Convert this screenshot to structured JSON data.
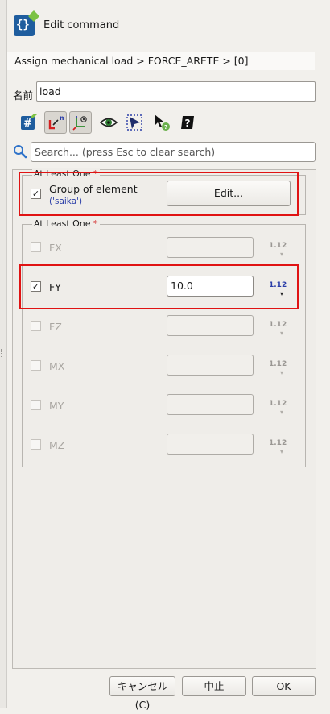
{
  "header": {
    "title": "Edit command"
  },
  "path": "Assign mechanical load > FORCE_ARETE > [0]",
  "name": {
    "label": "名前",
    "value": "load"
  },
  "toolbar": [
    {
      "icon": "hash-icon",
      "pressed": false
    },
    {
      "icon": "local-frame-icon",
      "pressed": true
    },
    {
      "icon": "axes-view-icon",
      "pressed": true
    },
    {
      "icon": "eye-icon",
      "pressed": false
    },
    {
      "icon": "select-arrow-icon",
      "pressed": false
    },
    {
      "icon": "cursor-help-icon",
      "pressed": false
    },
    {
      "icon": "question-book-icon",
      "pressed": false
    }
  ],
  "search": {
    "placeholder": "Search... (press Esc to clear search)"
  },
  "group1": {
    "title": "At Least One",
    "required": "*",
    "item": {
      "label": "Group of element",
      "checked": true,
      "sublabel": "('saika')",
      "button": "Edit..."
    }
  },
  "group2": {
    "title": "At Least One",
    "required": "*",
    "unit": "1.12",
    "caret": "▾",
    "rows": [
      {
        "label": "FX",
        "checked": false,
        "enabled": false,
        "value": ""
      },
      {
        "label": "FY",
        "checked": true,
        "enabled": true,
        "value": "10.0"
      },
      {
        "label": "FZ",
        "checked": false,
        "enabled": false,
        "value": ""
      },
      {
        "label": "MX",
        "checked": false,
        "enabled": false,
        "value": ""
      },
      {
        "label": "MY",
        "checked": false,
        "enabled": false,
        "value": ""
      },
      {
        "label": "MZ",
        "checked": false,
        "enabled": false,
        "value": ""
      }
    ]
  },
  "footer": {
    "cancel": "キャンセル(C)",
    "abort": "中止",
    "ok": "OK"
  },
  "colors": {
    "accent": "#2b3ea8",
    "highlight": "#e01313",
    "brand": "#1f5d9e"
  }
}
